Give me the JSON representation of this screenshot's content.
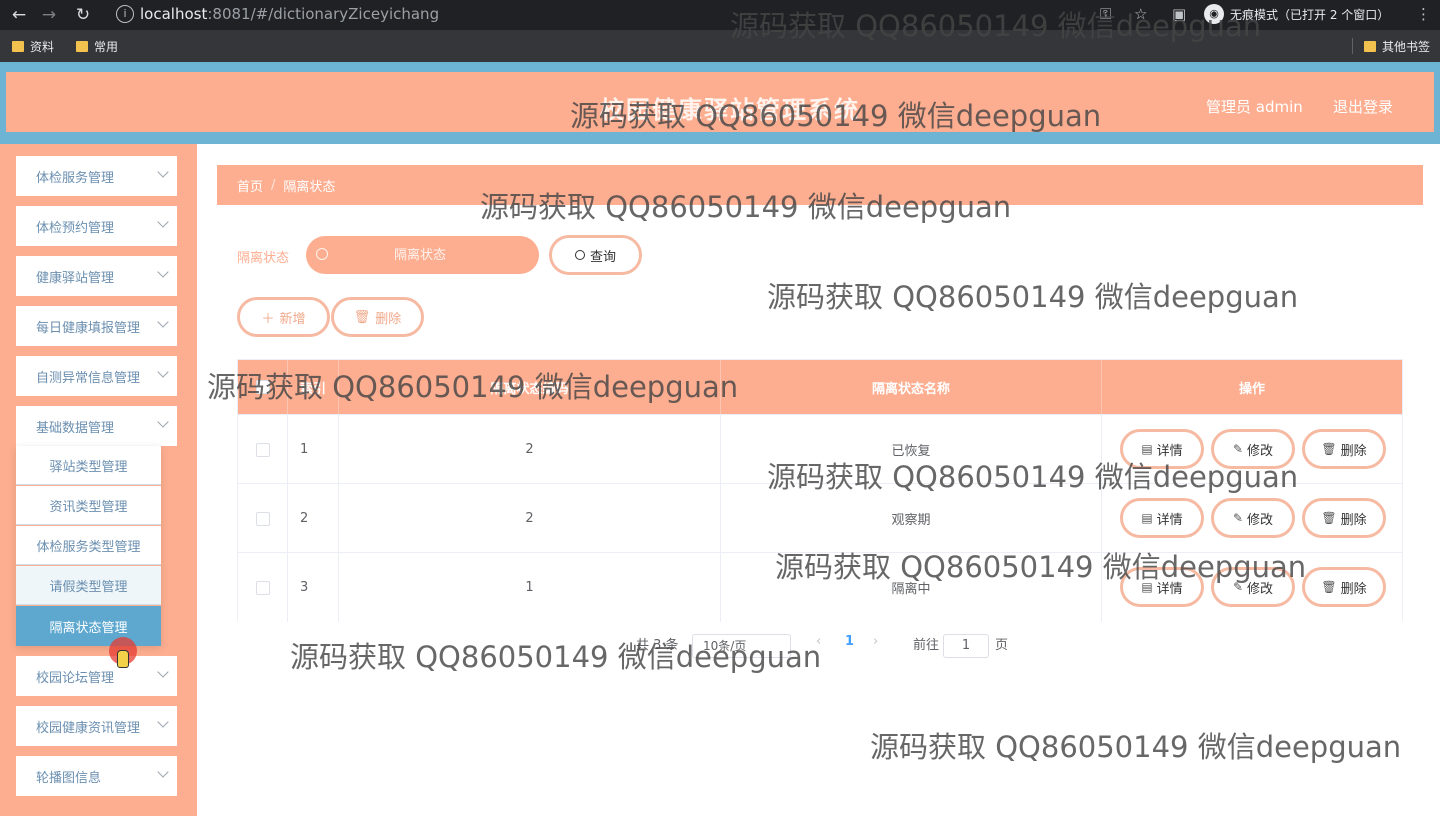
{
  "browser": {
    "url_host": "localhost",
    "url_rest": ":8081/#/dictionaryZiceyichang",
    "incognito_label": "无痕模式（已打开 2 个窗口）",
    "bookmarks": [
      "资料",
      "常用"
    ],
    "other_bookmarks": "其他书签"
  },
  "header": {
    "title": "校园健康驿站管理系统",
    "admin_label": "管理员 admin",
    "logout": "退出登录",
    "accent_color": "#fdae90",
    "strip_color": "#6db3d3"
  },
  "sidebar": {
    "items": [
      "体检服务管理",
      "体检预约管理",
      "健康驿站管理",
      "每日健康填报管理",
      "自测异常信息管理",
      "基础数据管理",
      "校园论坛管理",
      "校园健康资讯管理",
      "轮播图信息"
    ],
    "submenu": [
      "驿站类型管理",
      "资讯类型管理",
      "体检服务类型管理",
      "请假类型管理",
      "隔离状态管理"
    ],
    "active_submenu": "隔离状态管理"
  },
  "breadcrumb": [
    "首页",
    "隔离状态"
  ],
  "search": {
    "label": "隔离状态",
    "placeholder": "隔离状态",
    "button": "查询"
  },
  "actions": {
    "add": "新增",
    "delete": "删除"
  },
  "table": {
    "columns": [
      "索引",
      "隔离状态编码",
      "隔离状态名称",
      "操作"
    ],
    "rows": [
      {
        "index": "1",
        "code": "2",
        "name": "已恢复"
      },
      {
        "index": "2",
        "code": "2",
        "name": "观察期"
      },
      {
        "index": "3",
        "code": "1",
        "name": "隔离中"
      }
    ],
    "row_actions": [
      "详情",
      "修改",
      "删除"
    ]
  },
  "pagination": {
    "total": "共 3 条",
    "page_size": "10条/页",
    "current": "1",
    "goto_label": "前往",
    "goto_value": "1",
    "page_unit": "页"
  },
  "watermark": "源码获取 QQ86050149 微信deepguan"
}
